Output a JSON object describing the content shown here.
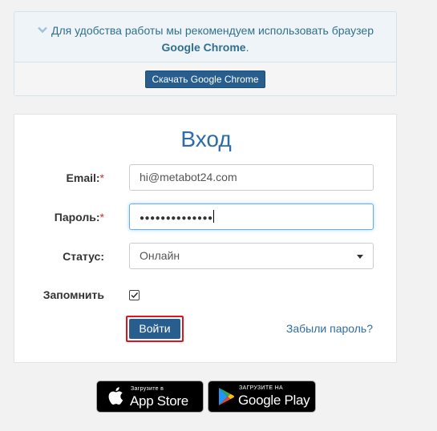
{
  "notice": {
    "text": "Для удобства работы мы рекомендуем использовать браузер",
    "browser": "Google Chrome",
    "period": ".",
    "download_label": "Скачать Google Chrome"
  },
  "login": {
    "title": "Вход",
    "email_label": "Email:",
    "email_value": "hi@metabot24.com",
    "password_label": "Пароль:",
    "password_mask": "●●●●●●●●●●●●●●",
    "status_label": "Статус:",
    "status_value": "Онлайн",
    "remember_label": "Запомнить",
    "remember_checked": true,
    "submit_label": "Войти",
    "forgot_label": "Забыли пароль?",
    "required_mark": "*"
  },
  "badges": {
    "appstore_small": "Загрузите в",
    "appstore_big": "App Store",
    "gplay_small": "ЗАГРУЗИТЕ НА",
    "gplay_big": "Google Play"
  },
  "colors": {
    "primary": "#285e8e",
    "link": "#2e6da4",
    "highlight": "#e0141e"
  },
  "icons": [
    "chevron-down-icon",
    "checkmark-icon",
    "select-caret-icon",
    "apple-icon",
    "google-play-icon"
  ]
}
